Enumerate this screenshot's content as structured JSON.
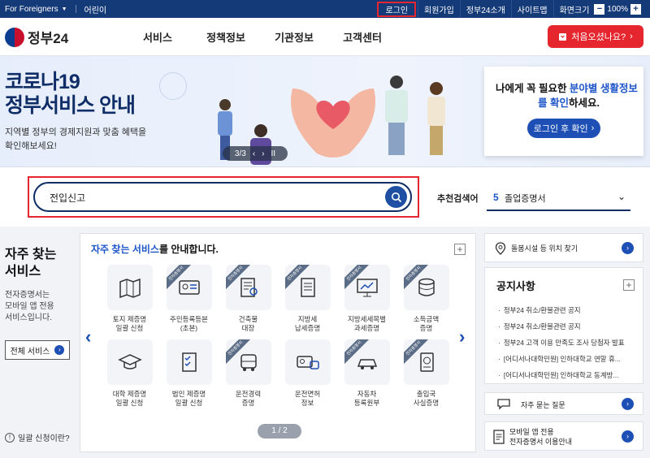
{
  "topbar": {
    "foreigners": "For Foreigners",
    "kids": "어린이",
    "login": "로그인",
    "signup": "회원가입",
    "intro": "정부24소개",
    "sitemap": "사이트맵",
    "zoom_label": "화면크기",
    "zoom_minus": "−",
    "zoom_value": "100%",
    "zoom_plus": "+"
  },
  "header": {
    "logo": "정부24",
    "nav": [
      "서비스",
      "정책정보",
      "기관정보",
      "고객센터"
    ],
    "first_visit": "처음오셨나요?"
  },
  "hero": {
    "title_line1": "코로나19",
    "title_line2": "정부서비스 안내",
    "sub_line1": "지역별 정부의 경제지원과 맞춤 혜택을",
    "sub_line2": "확인해보세요!",
    "slide": "3/3",
    "prev": "‹",
    "next": "›",
    "pause": "II"
  },
  "info_card": {
    "line1_a": "나에게 꼭 필요한 ",
    "line1_b": "분야별 생활정보",
    "line2_a": "를 확인",
    "line2_b": "하세요.",
    "button": "로그인 후 확인"
  },
  "search": {
    "value": "전입신고",
    "rec_label": "추천검색어",
    "rec_num": "5",
    "rec_text": "졸업증명서"
  },
  "left_col": {
    "title_line1": "자주 찾는",
    "title_line2": "서비스",
    "desc_line1": "전자증명서는",
    "desc_line2": "모바일 앱 전용",
    "desc_line3": "서비스입니다.",
    "all_btn": "전체 서비스",
    "help": "일괄 신청이란?"
  },
  "services": {
    "head_blue": "자주 찾는 서비스",
    "head_rest": "를 안내합니다.",
    "pager": "1 / 2",
    "tiles": [
      {
        "l1": "토지 제증명",
        "l2": "일괄 신청",
        "e": false
      },
      {
        "l1": "주민등록등본",
        "l2": "(초본)",
        "e": true
      },
      {
        "l1": "건축물",
        "l2": "대장",
        "e": true
      },
      {
        "l1": "지방세",
        "l2": "납세증명",
        "e": true
      },
      {
        "l1": "지방세세목별",
        "l2": "과세증명",
        "e": true
      },
      {
        "l1": "소득금액",
        "l2": "증명",
        "e": true
      },
      {
        "l1": "대학 제증명",
        "l2": "일괄 신청",
        "e": false
      },
      {
        "l1": "법인 제증명",
        "l2": "일괄 신청",
        "e": false
      },
      {
        "l1": "운전경력",
        "l2": "증명",
        "e": true
      },
      {
        "l1": "운전면허",
        "l2": "정보",
        "e": false
      },
      {
        "l1": "자동차",
        "l2": "등록원부",
        "e": true
      },
      {
        "l1": "출입국",
        "l2": "사실증명",
        "e": true
      }
    ]
  },
  "right_col": {
    "facility": "돌봄시설 등 위치 찾기",
    "notice_title": "공지사항",
    "notices": [
      "정부24 취소/환불관련 공지",
      "정부24 취소/환불관련 공지",
      "정부24 고객 이용 만족도 조사 당첨자 발표",
      "[어디서나대학민원] 인하대학교 연말 휴...",
      "[어디서나대학민원] 인하대학교 동계방..."
    ],
    "faq": "자주 묻는 질문",
    "mobile_line1": "모바일 앱 전용",
    "mobile_line2": "전자증명서 이용안내"
  },
  "colors": {
    "navy": "#153a78",
    "accent_blue": "#1d4fb5",
    "highlight_red": "#e6262e"
  }
}
